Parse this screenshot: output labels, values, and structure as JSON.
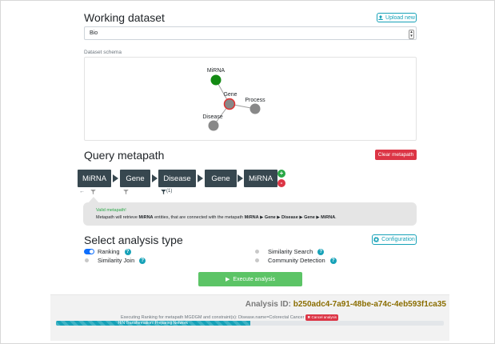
{
  "working_dataset": {
    "title": "Working dataset",
    "upload_label": "Upload new",
    "selected_value": "Bio",
    "schema_label": "Dataset schema"
  },
  "schema_graph": {
    "nodes": [
      {
        "label": "MiRNA",
        "color": "#138a13"
      },
      {
        "label": "Gene",
        "color": "#888888",
        "ring": "#e03030"
      },
      {
        "label": "Process",
        "color": "#888888"
      },
      {
        "label": "Disease",
        "color": "#888888"
      }
    ]
  },
  "query_metapath": {
    "title": "Query metapath",
    "clear_label": "Clear metapath",
    "nodes": [
      "MiRNA",
      "Gene",
      "Disease",
      "Gene",
      "MiRNA"
    ],
    "add_symbol": "+",
    "remove_symbol": "-",
    "filter_count": "(1)",
    "message_title": "Valid metapath!",
    "message_prefix": "Metapath will retrieve",
    "message_entity": "MiRNA",
    "message_middle": "entities, that are connected with the metapath",
    "message_path": [
      "MiRNA",
      "Gene",
      "Disease",
      "Gene",
      "MiRNA"
    ],
    "message_end": "."
  },
  "analysis_type": {
    "title": "Select analysis type",
    "config_label": "Configuration",
    "options": [
      {
        "label": "Ranking",
        "enabled": true
      },
      {
        "label": "Similarity Search",
        "enabled": false
      },
      {
        "label": "Similarity Join",
        "enabled": false
      },
      {
        "label": "Community Detection",
        "enabled": false
      }
    ],
    "execute_label": "Execute analysis"
  },
  "result": {
    "id_label": "Analysis ID:",
    "id_value": "b250adc4-7a91-48be-a74c-4eb593f1ca35",
    "status_text": "Executing Ranking for metapath MGDGM and constraint(s): Disease.name=Colorectal Cancer",
    "cancel_label": "Cancel analysis",
    "progress_label": "HIN Transformation: Preparing Network",
    "progress_fraction": 0.5
  },
  "colors": {
    "accent": "#17a2b8",
    "danger": "#dc3545",
    "success": "#5cc466",
    "node": "#37474f",
    "gold": "#8a6d00"
  }
}
